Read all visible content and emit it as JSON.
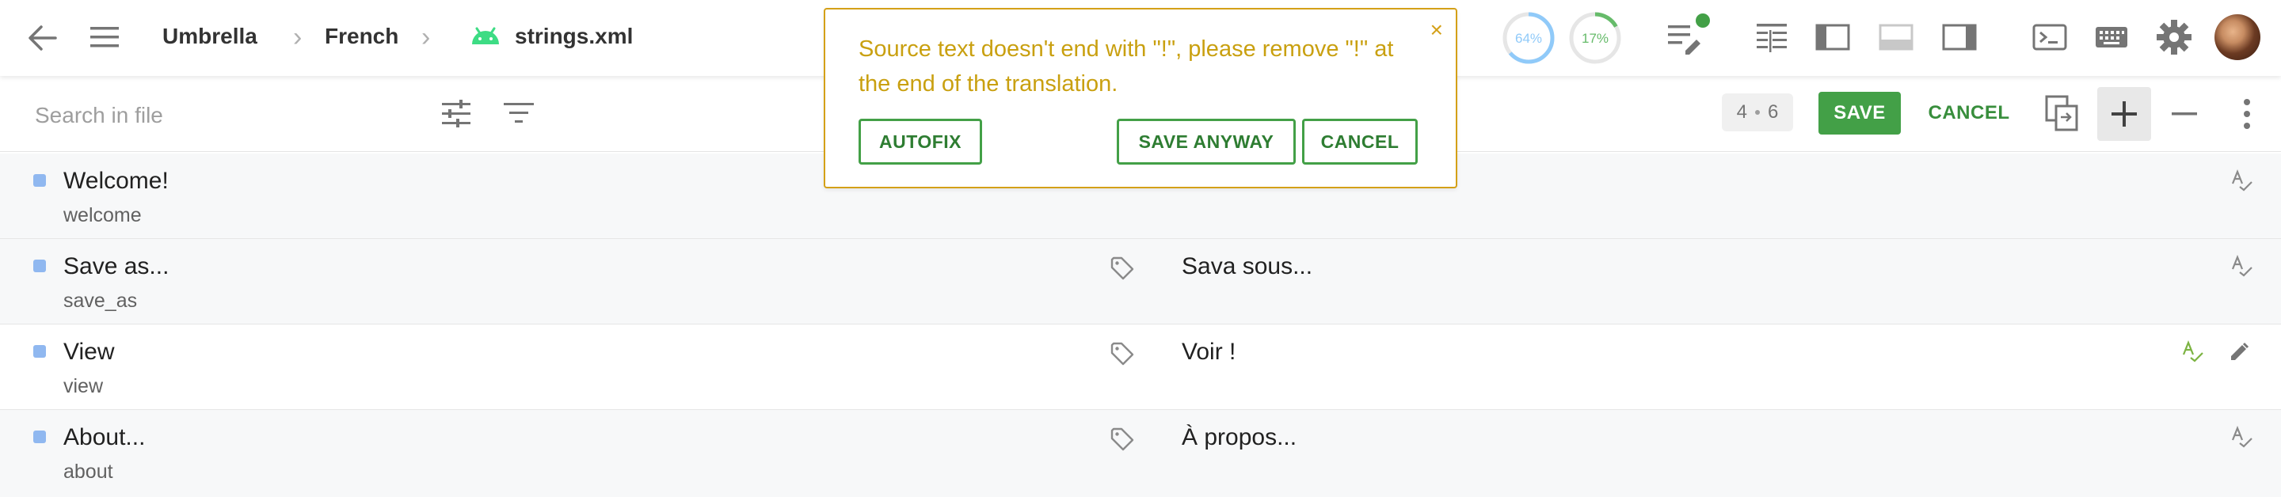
{
  "breadcrumb": {
    "project": "Umbrella",
    "language": "French",
    "file": "strings.xml"
  },
  "progress": [
    {
      "label": "64%",
      "value": 64,
      "color": "#90caf9"
    },
    {
      "label": "17%",
      "value": 17,
      "color": "#66bb6a"
    }
  ],
  "search": {
    "placeholder": "Search in file",
    "value": ""
  },
  "counter": {
    "current": "4",
    "total": "6"
  },
  "toolbar": {
    "save_label": "SAVE",
    "cancel_label": "CANCEL"
  },
  "warning": {
    "message": "Source text doesn't end with \"!\", please remove \"!\" at the end of the translation.",
    "close": "×",
    "autofix_label": "AUTOFIX",
    "save_anyway_label": "SAVE ANYWAY",
    "cancel_label": "CANCEL"
  },
  "rows": [
    {
      "source": "Welcome!",
      "key": "welcome",
      "translation": ""
    },
    {
      "source": "Save as...",
      "key": "save_as",
      "translation": "Sava sous..."
    },
    {
      "source": "View",
      "key": "view",
      "translation": "Voir !"
    },
    {
      "source": "About...",
      "key": "about",
      "translation": "À propos..."
    }
  ],
  "colors": {
    "accent": "#43a047",
    "warning": "#d4a017",
    "marker": "#90b8f0",
    "android": "#3ddc84"
  }
}
